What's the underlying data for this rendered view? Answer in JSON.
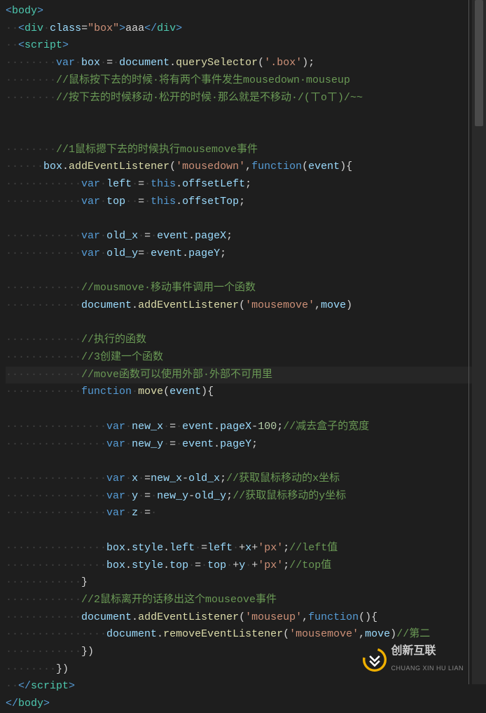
{
  "lines": [
    {
      "segs": [
        {
          "c": "tag",
          "t": "<"
        },
        {
          "c": "tagname",
          "t": "body"
        },
        {
          "c": "tag",
          "t": ">"
        }
      ]
    },
    {
      "segs": [
        {
          "c": "ws",
          "t": "··"
        },
        {
          "c": "tag",
          "t": "<"
        },
        {
          "c": "tagname",
          "t": "div"
        },
        {
          "c": "ws",
          "t": "·"
        },
        {
          "c": "attr",
          "t": "class"
        },
        {
          "c": "punct",
          "t": "="
        },
        {
          "c": "string",
          "t": "\"box\""
        },
        {
          "c": "tag",
          "t": ">"
        },
        {
          "c": "text",
          "t": "aaa"
        },
        {
          "c": "tag",
          "t": "</"
        },
        {
          "c": "tagname",
          "t": "div"
        },
        {
          "c": "tag",
          "t": ">"
        }
      ]
    },
    {
      "segs": [
        {
          "c": "ws",
          "t": "··"
        },
        {
          "c": "tag",
          "t": "<"
        },
        {
          "c": "tagname",
          "t": "script"
        },
        {
          "c": "tag",
          "t": ">"
        }
      ]
    },
    {
      "segs": [
        {
          "c": "ws",
          "t": "········"
        },
        {
          "c": "keyword",
          "t": "var"
        },
        {
          "c": "ws",
          "t": "·"
        },
        {
          "c": "var",
          "t": "box"
        },
        {
          "c": "ws",
          "t": "·"
        },
        {
          "c": "op",
          "t": "="
        },
        {
          "c": "ws",
          "t": "·"
        },
        {
          "c": "var",
          "t": "document"
        },
        {
          "c": "punct",
          "t": "."
        },
        {
          "c": "func",
          "t": "querySelector"
        },
        {
          "c": "punct",
          "t": "("
        },
        {
          "c": "string",
          "t": "'.box'"
        },
        {
          "c": "punct",
          "t": ");"
        }
      ]
    },
    {
      "segs": [
        {
          "c": "ws",
          "t": "········"
        },
        {
          "c": "comment",
          "t": "//鼠标按下去的时候·将有两个事件发生mousedown·mouseup"
        }
      ]
    },
    {
      "segs": [
        {
          "c": "ws",
          "t": "········"
        },
        {
          "c": "comment",
          "t": "//按下去的时候移动·松开的时候·那么就是不移动·/(ㄒoㄒ)/~~"
        }
      ]
    },
    {
      "segs": []
    },
    {
      "segs": []
    },
    {
      "segs": [
        {
          "c": "ws",
          "t": "········"
        },
        {
          "c": "comment",
          "t": "//1鼠标摁下去的时候执行mousemove事件"
        }
      ]
    },
    {
      "segs": [
        {
          "c": "ws",
          "t": "······"
        },
        {
          "c": "var",
          "t": "box"
        },
        {
          "c": "punct",
          "t": "."
        },
        {
          "c": "func",
          "t": "addEventListener"
        },
        {
          "c": "punct",
          "t": "("
        },
        {
          "c": "string",
          "t": "'mousedown'"
        },
        {
          "c": "punct",
          "t": ","
        },
        {
          "c": "keyword",
          "t": "function"
        },
        {
          "c": "punct",
          "t": "("
        },
        {
          "c": "var",
          "t": "event"
        },
        {
          "c": "punct",
          "t": ")"
        },
        {
          "c": "punct",
          "t": "{"
        }
      ]
    },
    {
      "segs": [
        {
          "c": "ws",
          "t": "············"
        },
        {
          "c": "keyword",
          "t": "var"
        },
        {
          "c": "ws",
          "t": "·"
        },
        {
          "c": "var",
          "t": "left"
        },
        {
          "c": "ws",
          "t": "·"
        },
        {
          "c": "op",
          "t": "="
        },
        {
          "c": "ws",
          "t": "·"
        },
        {
          "c": "this",
          "t": "this"
        },
        {
          "c": "punct",
          "t": "."
        },
        {
          "c": "prop",
          "t": "offsetLeft"
        },
        {
          "c": "punct",
          "t": ";"
        }
      ]
    },
    {
      "segs": [
        {
          "c": "ws",
          "t": "············"
        },
        {
          "c": "keyword",
          "t": "var"
        },
        {
          "c": "ws",
          "t": "·"
        },
        {
          "c": "var",
          "t": "top"
        },
        {
          "c": "ws",
          "t": "··"
        },
        {
          "c": "op",
          "t": "="
        },
        {
          "c": "ws",
          "t": "·"
        },
        {
          "c": "this",
          "t": "this"
        },
        {
          "c": "punct",
          "t": "."
        },
        {
          "c": "prop",
          "t": "offsetTop"
        },
        {
          "c": "punct",
          "t": ";"
        }
      ]
    },
    {
      "segs": []
    },
    {
      "segs": [
        {
          "c": "ws",
          "t": "············"
        },
        {
          "c": "keyword",
          "t": "var"
        },
        {
          "c": "ws",
          "t": "·"
        },
        {
          "c": "var",
          "t": "old_x"
        },
        {
          "c": "ws",
          "t": "·"
        },
        {
          "c": "op",
          "t": "="
        },
        {
          "c": "ws",
          "t": "·"
        },
        {
          "c": "var",
          "t": "event"
        },
        {
          "c": "punct",
          "t": "."
        },
        {
          "c": "prop",
          "t": "pageX"
        },
        {
          "c": "punct",
          "t": ";"
        }
      ]
    },
    {
      "segs": [
        {
          "c": "ws",
          "t": "············"
        },
        {
          "c": "keyword",
          "t": "var"
        },
        {
          "c": "ws",
          "t": "·"
        },
        {
          "c": "var",
          "t": "old_y"
        },
        {
          "c": "op",
          "t": "="
        },
        {
          "c": "ws",
          "t": "·"
        },
        {
          "c": "var",
          "t": "event"
        },
        {
          "c": "punct",
          "t": "."
        },
        {
          "c": "prop",
          "t": "pageY"
        },
        {
          "c": "punct",
          "t": ";"
        }
      ]
    },
    {
      "segs": []
    },
    {
      "segs": [
        {
          "c": "ws",
          "t": "············"
        },
        {
          "c": "comment",
          "t": "//mousmove·移动事件调用一个函数"
        }
      ]
    },
    {
      "segs": [
        {
          "c": "ws",
          "t": "············"
        },
        {
          "c": "var",
          "t": "document"
        },
        {
          "c": "punct",
          "t": "."
        },
        {
          "c": "func",
          "t": "addEventListener"
        },
        {
          "c": "punct",
          "t": "("
        },
        {
          "c": "string",
          "t": "'mousemove'"
        },
        {
          "c": "punct",
          "t": ","
        },
        {
          "c": "var",
          "t": "move"
        },
        {
          "c": "punct",
          "t": ")"
        }
      ]
    },
    {
      "segs": []
    },
    {
      "segs": [
        {
          "c": "ws",
          "t": "············"
        },
        {
          "c": "comment",
          "t": "//执行的函数"
        }
      ]
    },
    {
      "segs": [
        {
          "c": "ws",
          "t": "············"
        },
        {
          "c": "comment",
          "t": "//3创建一个函数"
        }
      ]
    },
    {
      "segs": [
        {
          "c": "ws",
          "t": "············"
        },
        {
          "c": "comment",
          "t": "//move函数可以使用外部·外部不可用里"
        }
      ],
      "hl": true
    },
    {
      "segs": [
        {
          "c": "ws",
          "t": "············"
        },
        {
          "c": "keyword",
          "t": "function"
        },
        {
          "c": "ws",
          "t": "·"
        },
        {
          "c": "func",
          "t": "move"
        },
        {
          "c": "punct",
          "t": "("
        },
        {
          "c": "var",
          "t": "event"
        },
        {
          "c": "punct",
          "t": "){"
        }
      ]
    },
    {
      "segs": []
    },
    {
      "segs": [
        {
          "c": "ws",
          "t": "················"
        },
        {
          "c": "keyword",
          "t": "var"
        },
        {
          "c": "ws",
          "t": "·"
        },
        {
          "c": "var",
          "t": "new_x"
        },
        {
          "c": "ws",
          "t": "·"
        },
        {
          "c": "op",
          "t": "="
        },
        {
          "c": "ws",
          "t": "·"
        },
        {
          "c": "var",
          "t": "event"
        },
        {
          "c": "punct",
          "t": "."
        },
        {
          "c": "prop",
          "t": "pageX"
        },
        {
          "c": "op",
          "t": "-"
        },
        {
          "c": "num",
          "t": "100"
        },
        {
          "c": "punct",
          "t": ";"
        },
        {
          "c": "comment",
          "t": "//减去盒子的宽度"
        }
      ]
    },
    {
      "segs": [
        {
          "c": "ws",
          "t": "················"
        },
        {
          "c": "keyword",
          "t": "var"
        },
        {
          "c": "ws",
          "t": "·"
        },
        {
          "c": "var",
          "t": "new_y"
        },
        {
          "c": "ws",
          "t": "·"
        },
        {
          "c": "op",
          "t": "="
        },
        {
          "c": "ws",
          "t": "·"
        },
        {
          "c": "var",
          "t": "event"
        },
        {
          "c": "punct",
          "t": "."
        },
        {
          "c": "prop",
          "t": "pageY"
        },
        {
          "c": "punct",
          "t": ";"
        }
      ]
    },
    {
      "segs": []
    },
    {
      "segs": [
        {
          "c": "ws",
          "t": "················"
        },
        {
          "c": "keyword",
          "t": "var"
        },
        {
          "c": "ws",
          "t": "·"
        },
        {
          "c": "var",
          "t": "x"
        },
        {
          "c": "ws",
          "t": "·"
        },
        {
          "c": "op",
          "t": "="
        },
        {
          "c": "var",
          "t": "new_x"
        },
        {
          "c": "op",
          "t": "-"
        },
        {
          "c": "var",
          "t": "old_x"
        },
        {
          "c": "punct",
          "t": ";"
        },
        {
          "c": "comment",
          "t": "//获取鼠标移动的x坐标"
        }
      ]
    },
    {
      "segs": [
        {
          "c": "ws",
          "t": "················"
        },
        {
          "c": "keyword",
          "t": "var"
        },
        {
          "c": "ws",
          "t": "·"
        },
        {
          "c": "var",
          "t": "y"
        },
        {
          "c": "ws",
          "t": "·"
        },
        {
          "c": "op",
          "t": "="
        },
        {
          "c": "ws",
          "t": "·"
        },
        {
          "c": "var",
          "t": "new_y"
        },
        {
          "c": "op",
          "t": "-"
        },
        {
          "c": "var",
          "t": "old_y"
        },
        {
          "c": "punct",
          "t": ";"
        },
        {
          "c": "comment",
          "t": "//获取鼠标移动的y坐标"
        }
      ]
    },
    {
      "segs": [
        {
          "c": "ws",
          "t": "················"
        },
        {
          "c": "keyword",
          "t": "var"
        },
        {
          "c": "ws",
          "t": "·"
        },
        {
          "c": "var",
          "t": "z"
        },
        {
          "c": "ws",
          "t": "·"
        },
        {
          "c": "op",
          "t": "="
        },
        {
          "c": "ws",
          "t": "·"
        }
      ]
    },
    {
      "segs": []
    },
    {
      "segs": [
        {
          "c": "ws",
          "t": "················"
        },
        {
          "c": "var",
          "t": "box"
        },
        {
          "c": "punct",
          "t": "."
        },
        {
          "c": "prop",
          "t": "style"
        },
        {
          "c": "punct",
          "t": "."
        },
        {
          "c": "prop",
          "t": "left"
        },
        {
          "c": "ws",
          "t": "·"
        },
        {
          "c": "op",
          "t": "="
        },
        {
          "c": "var",
          "t": "left"
        },
        {
          "c": "ws",
          "t": "·"
        },
        {
          "c": "op",
          "t": "+"
        },
        {
          "c": "var",
          "t": "x"
        },
        {
          "c": "op",
          "t": "+"
        },
        {
          "c": "string",
          "t": "'px'"
        },
        {
          "c": "punct",
          "t": ";"
        },
        {
          "c": "comment",
          "t": "//left值"
        }
      ]
    },
    {
      "segs": [
        {
          "c": "ws",
          "t": "················"
        },
        {
          "c": "var",
          "t": "box"
        },
        {
          "c": "punct",
          "t": "."
        },
        {
          "c": "prop",
          "t": "style"
        },
        {
          "c": "punct",
          "t": "."
        },
        {
          "c": "prop",
          "t": "top"
        },
        {
          "c": "ws",
          "t": "·"
        },
        {
          "c": "op",
          "t": "="
        },
        {
          "c": "ws",
          "t": "·"
        },
        {
          "c": "var",
          "t": "top"
        },
        {
          "c": "ws",
          "t": "·"
        },
        {
          "c": "op",
          "t": "+"
        },
        {
          "c": "var",
          "t": "y"
        },
        {
          "c": "ws",
          "t": "·"
        },
        {
          "c": "op",
          "t": "+"
        },
        {
          "c": "string",
          "t": "'px'"
        },
        {
          "c": "punct",
          "t": ";"
        },
        {
          "c": "comment",
          "t": "//top值"
        }
      ]
    },
    {
      "segs": [
        {
          "c": "ws",
          "t": "············"
        },
        {
          "c": "punct",
          "t": "}"
        }
      ]
    },
    {
      "segs": [
        {
          "c": "ws",
          "t": "············"
        },
        {
          "c": "comment",
          "t": "//2鼠标离开的话移出这个mouseove事件"
        }
      ]
    },
    {
      "segs": [
        {
          "c": "ws",
          "t": "············"
        },
        {
          "c": "var",
          "t": "document"
        },
        {
          "c": "punct",
          "t": "."
        },
        {
          "c": "func",
          "t": "addEventListener"
        },
        {
          "c": "punct",
          "t": "("
        },
        {
          "c": "string",
          "t": "'mouseup'"
        },
        {
          "c": "punct",
          "t": ","
        },
        {
          "c": "keyword",
          "t": "function"
        },
        {
          "c": "punct",
          "t": "(){"
        }
      ]
    },
    {
      "segs": [
        {
          "c": "ws",
          "t": "················"
        },
        {
          "c": "var",
          "t": "document"
        },
        {
          "c": "punct",
          "t": "."
        },
        {
          "c": "func",
          "t": "removeEventListener"
        },
        {
          "c": "punct",
          "t": "("
        },
        {
          "c": "string",
          "t": "'mousemove'"
        },
        {
          "c": "punct",
          "t": ","
        },
        {
          "c": "var",
          "t": "move"
        },
        {
          "c": "punct",
          "t": ")"
        },
        {
          "c": "comment",
          "t": "//第二"
        }
      ]
    },
    {
      "segs": [
        {
          "c": "ws",
          "t": "············"
        },
        {
          "c": "punct",
          "t": "})"
        }
      ]
    },
    {
      "segs": [
        {
          "c": "ws",
          "t": "········"
        },
        {
          "c": "punct",
          "t": "})"
        }
      ]
    },
    {
      "segs": [
        {
          "c": "ws",
          "t": "··"
        },
        {
          "c": "tag",
          "t": "</"
        },
        {
          "c": "tagname",
          "t": "script"
        },
        {
          "c": "tag",
          "t": ">"
        }
      ]
    },
    {
      "segs": [
        {
          "c": "tag",
          "t": "</"
        },
        {
          "c": "tagname",
          "t": "body"
        },
        {
          "c": "tag",
          "t": ">"
        }
      ]
    }
  ],
  "watermark": {
    "cn": "创新互联",
    "en": "CHUANG XIN HU LIAN"
  }
}
